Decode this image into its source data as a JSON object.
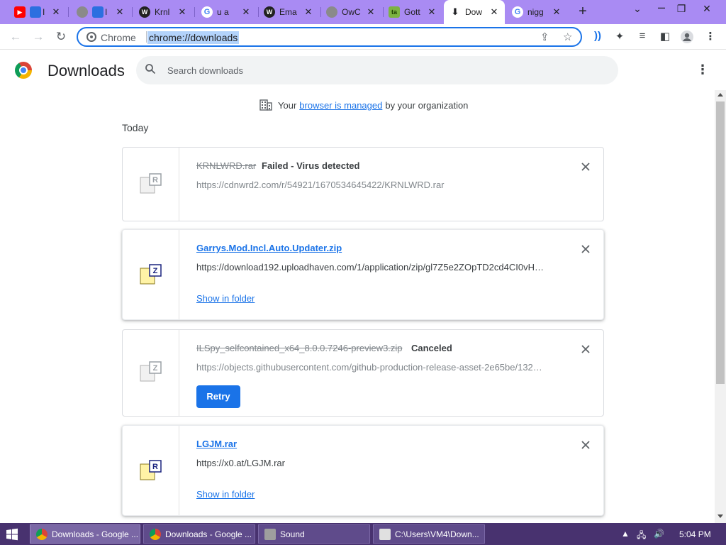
{
  "tabs": [
    {
      "label": "I",
      "icon": "youtube-icon"
    },
    {
      "label": "I",
      "icon": "globe-icon"
    },
    {
      "label": "Krnl",
      "icon": "site-icon"
    },
    {
      "label": "u a",
      "icon": "google-icon"
    },
    {
      "label": "Ema",
      "icon": "site-icon"
    },
    {
      "label": "OwC",
      "icon": "globe-icon"
    },
    {
      "label": "Gott",
      "icon": "ta-icon"
    },
    {
      "label": "Dow",
      "icon": "download-icon"
    },
    {
      "label": "nigg",
      "icon": "google-icon"
    }
  ],
  "tab_close_symbol": "✕",
  "new_tab_symbol": "+",
  "window_controls": {
    "tab_search": "⌄",
    "restore": "❐",
    "close": "✕"
  },
  "omnibox": {
    "site_label": "Chrome",
    "url": "chrome://downloads"
  },
  "header": {
    "title": "Downloads",
    "search_placeholder": "Search downloads"
  },
  "managed": {
    "prefix": "Your",
    "link": "browser is managed",
    "suffix": "by your organization"
  },
  "section": "Today",
  "downloads": [
    {
      "filename": "KRNLWRD.rar",
      "status": "Failed - Virus detected",
      "url": "https://cdnwrd2.com/r/54921/1670534645422/KRNLWRD.rar",
      "icon_letter": "R"
    },
    {
      "filename": "Garrys.Mod.Incl.Auto.Updater.zip",
      "url": "https://download192.uploadhaven.com/1/application/zip/gl7Z5e2ZOpTD2cd4CI0vH…",
      "action": "Show in folder",
      "icon_letter": "Z"
    },
    {
      "filename": "ILSpy_selfcontained_x64_8.0.0.7246-preview3.zip",
      "status": "Canceled",
      "url": "https://objects.githubusercontent.com/github-production-release-asset-2e65be/132…",
      "action": "Retry",
      "icon_letter": "Z"
    },
    {
      "filename": "LGJM.rar",
      "url": "https://x0.at/LGJM.rar",
      "action": "Show in folder",
      "icon_letter": "R"
    }
  ],
  "taskbar": {
    "tasks": [
      {
        "label": "Downloads - Google ..."
      },
      {
        "label": "Downloads - Google ..."
      },
      {
        "label": "Sound"
      },
      {
        "label": "C:\\Users\\VM4\\Down..."
      }
    ],
    "clock": "5:04 PM"
  },
  "colors": {
    "accent": "#1a73e8",
    "tabstrip": "#a98bf3",
    "taskbar": "#48326f"
  }
}
